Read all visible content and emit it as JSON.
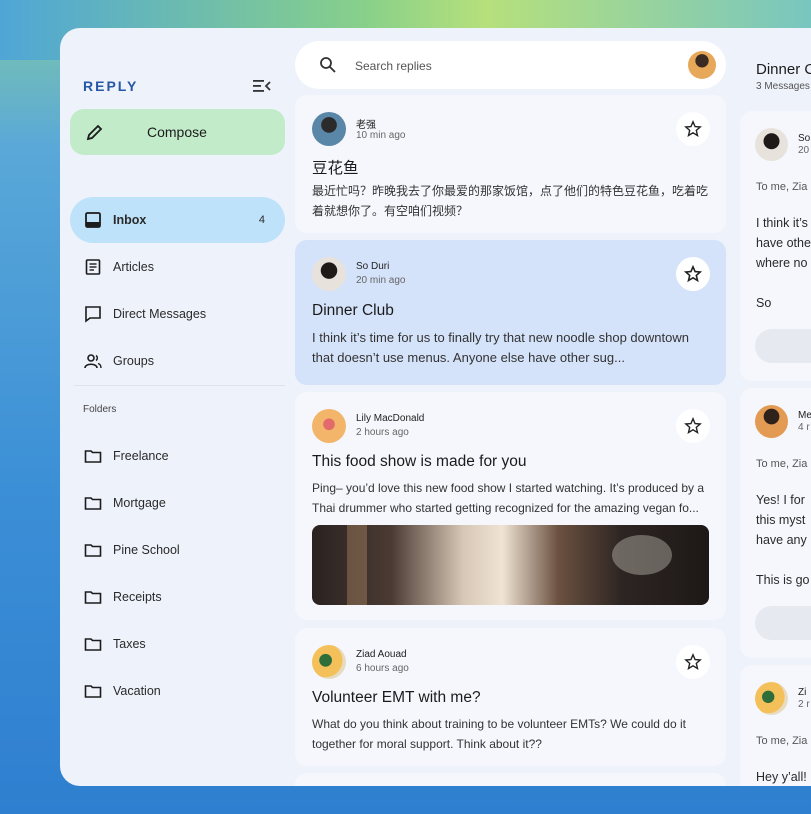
{
  "brand": "REPLY",
  "compose_label": "Compose",
  "search_placeholder": "Search replies",
  "nav": [
    {
      "label": "Inbox",
      "count": "4"
    },
    {
      "label": "Articles"
    },
    {
      "label": "Direct Messages"
    },
    {
      "label": "Groups"
    }
  ],
  "folders_label": "Folders",
  "folders": [
    "Freelance",
    "Mortgage",
    "Pine School",
    "Receipts",
    "Taxes",
    "Vacation"
  ],
  "emails": [
    {
      "sender": "老强",
      "time": "10 min ago",
      "subject": "豆花鱼",
      "body": "最近忙吗？昨晚我去了你最爱的那家饭馆，点了他们的特色豆花鱼，吃着吃着就想你了。有空咱们视频？"
    },
    {
      "sender": "So Duri",
      "time": "20 min ago",
      "subject": "Dinner Club",
      "body": "I think it’s time for us to finally try that new noodle shop downtown that doesn’t use menus. Anyone else have other sug..."
    },
    {
      "sender": "Lily MacDonald",
      "time": "2 hours ago",
      "subject": "This food show is made for you",
      "body": "Ping– you’d love this new food show I started watching. It’s produced by a Thai drummer who started getting recognized for the amazing vegan fo..."
    },
    {
      "sender": "Ziad Aouad",
      "time": "6 hours ago",
      "subject": "Volunteer EMT with me?",
      "body": "What do you think about training to be volunteer EMTs? We could do it together for moral support. Think about it??"
    }
  ],
  "detail": {
    "title": "Dinner C",
    "meta": "3 Messages",
    "messages": [
      {
        "name": "So",
        "time": "20",
        "to": "To me, Zia",
        "lines": [
          "I think it’s",
          "have othe",
          "where no",
          "",
          "So"
        ]
      },
      {
        "name": "Me",
        "time": "4 r",
        "to": "To me, Zia",
        "lines": [
          "Yes! I for",
          "this myst",
          "have any",
          "",
          "This is go"
        ]
      },
      {
        "name": "Zi",
        "time": "2 r",
        "to": "To me, Zia",
        "lines": [
          "Hey y’all!"
        ]
      }
    ]
  }
}
